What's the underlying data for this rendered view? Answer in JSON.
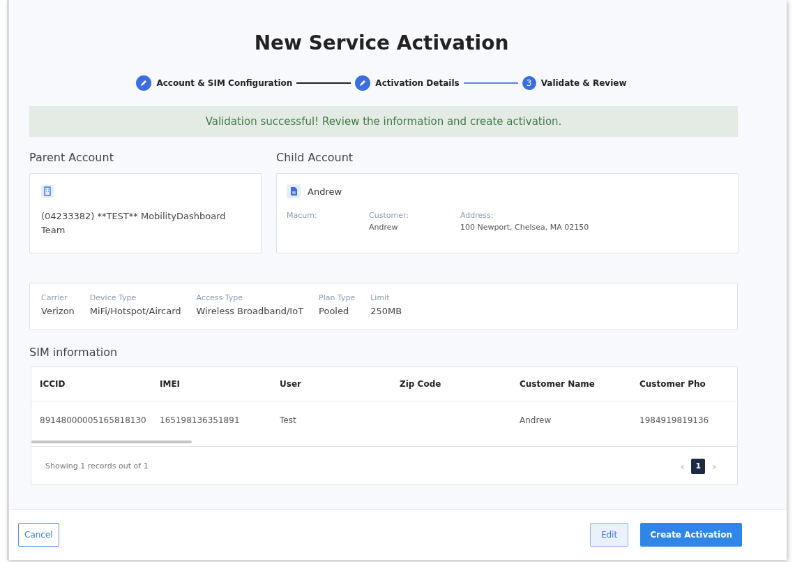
{
  "title": "New Service Activation",
  "steps": [
    {
      "label": "Account & SIM Configuration",
      "kind": "done"
    },
    {
      "label": "Activation Details",
      "kind": "done"
    },
    {
      "label": "Validate & Review",
      "kind": "current",
      "number": "3"
    }
  ],
  "banner": "Validation successful! Review the information and create activation.",
  "parent_account": {
    "heading": "Parent Account",
    "name": "(04233382) **TEST** MobilityDashboard Team"
  },
  "child_account": {
    "heading": "Child Account",
    "name": "Andrew",
    "fields": [
      {
        "label": "Macum:"
      },
      {
        "label": "Customer:",
        "value": "Andrew"
      },
      {
        "label": "Address:",
        "value": "100 Newport, Chelsea, MA 02150"
      }
    ]
  },
  "plan": [
    {
      "label": "Carrier",
      "value": "Verizon"
    },
    {
      "label": "Device Type",
      "value": "MiFi/Hotspot/Aircard"
    },
    {
      "label": "Access Type",
      "value": "Wireless Broadband/IoT"
    },
    {
      "label": "Plan Type",
      "value": "Pooled"
    },
    {
      "label": "Limit",
      "value": "250MB"
    }
  ],
  "sim": {
    "heading": "SIM information",
    "columns": [
      "ICCID",
      "IMEI",
      "User",
      "Zip Code",
      "Customer Name",
      "Customer Pho"
    ],
    "rows": [
      [
        "89148000005165818130",
        "165198136351891",
        "Test",
        "",
        "Andrew",
        "1984919819136"
      ]
    ],
    "summary": "Showing 1 records out of 1",
    "prev": "‹",
    "next": "›",
    "pages": [
      {
        "label": "1",
        "selected": true
      }
    ]
  },
  "buttons": {
    "cancel": "Cancel",
    "edit": "Edit",
    "create": "Create Activation"
  }
}
